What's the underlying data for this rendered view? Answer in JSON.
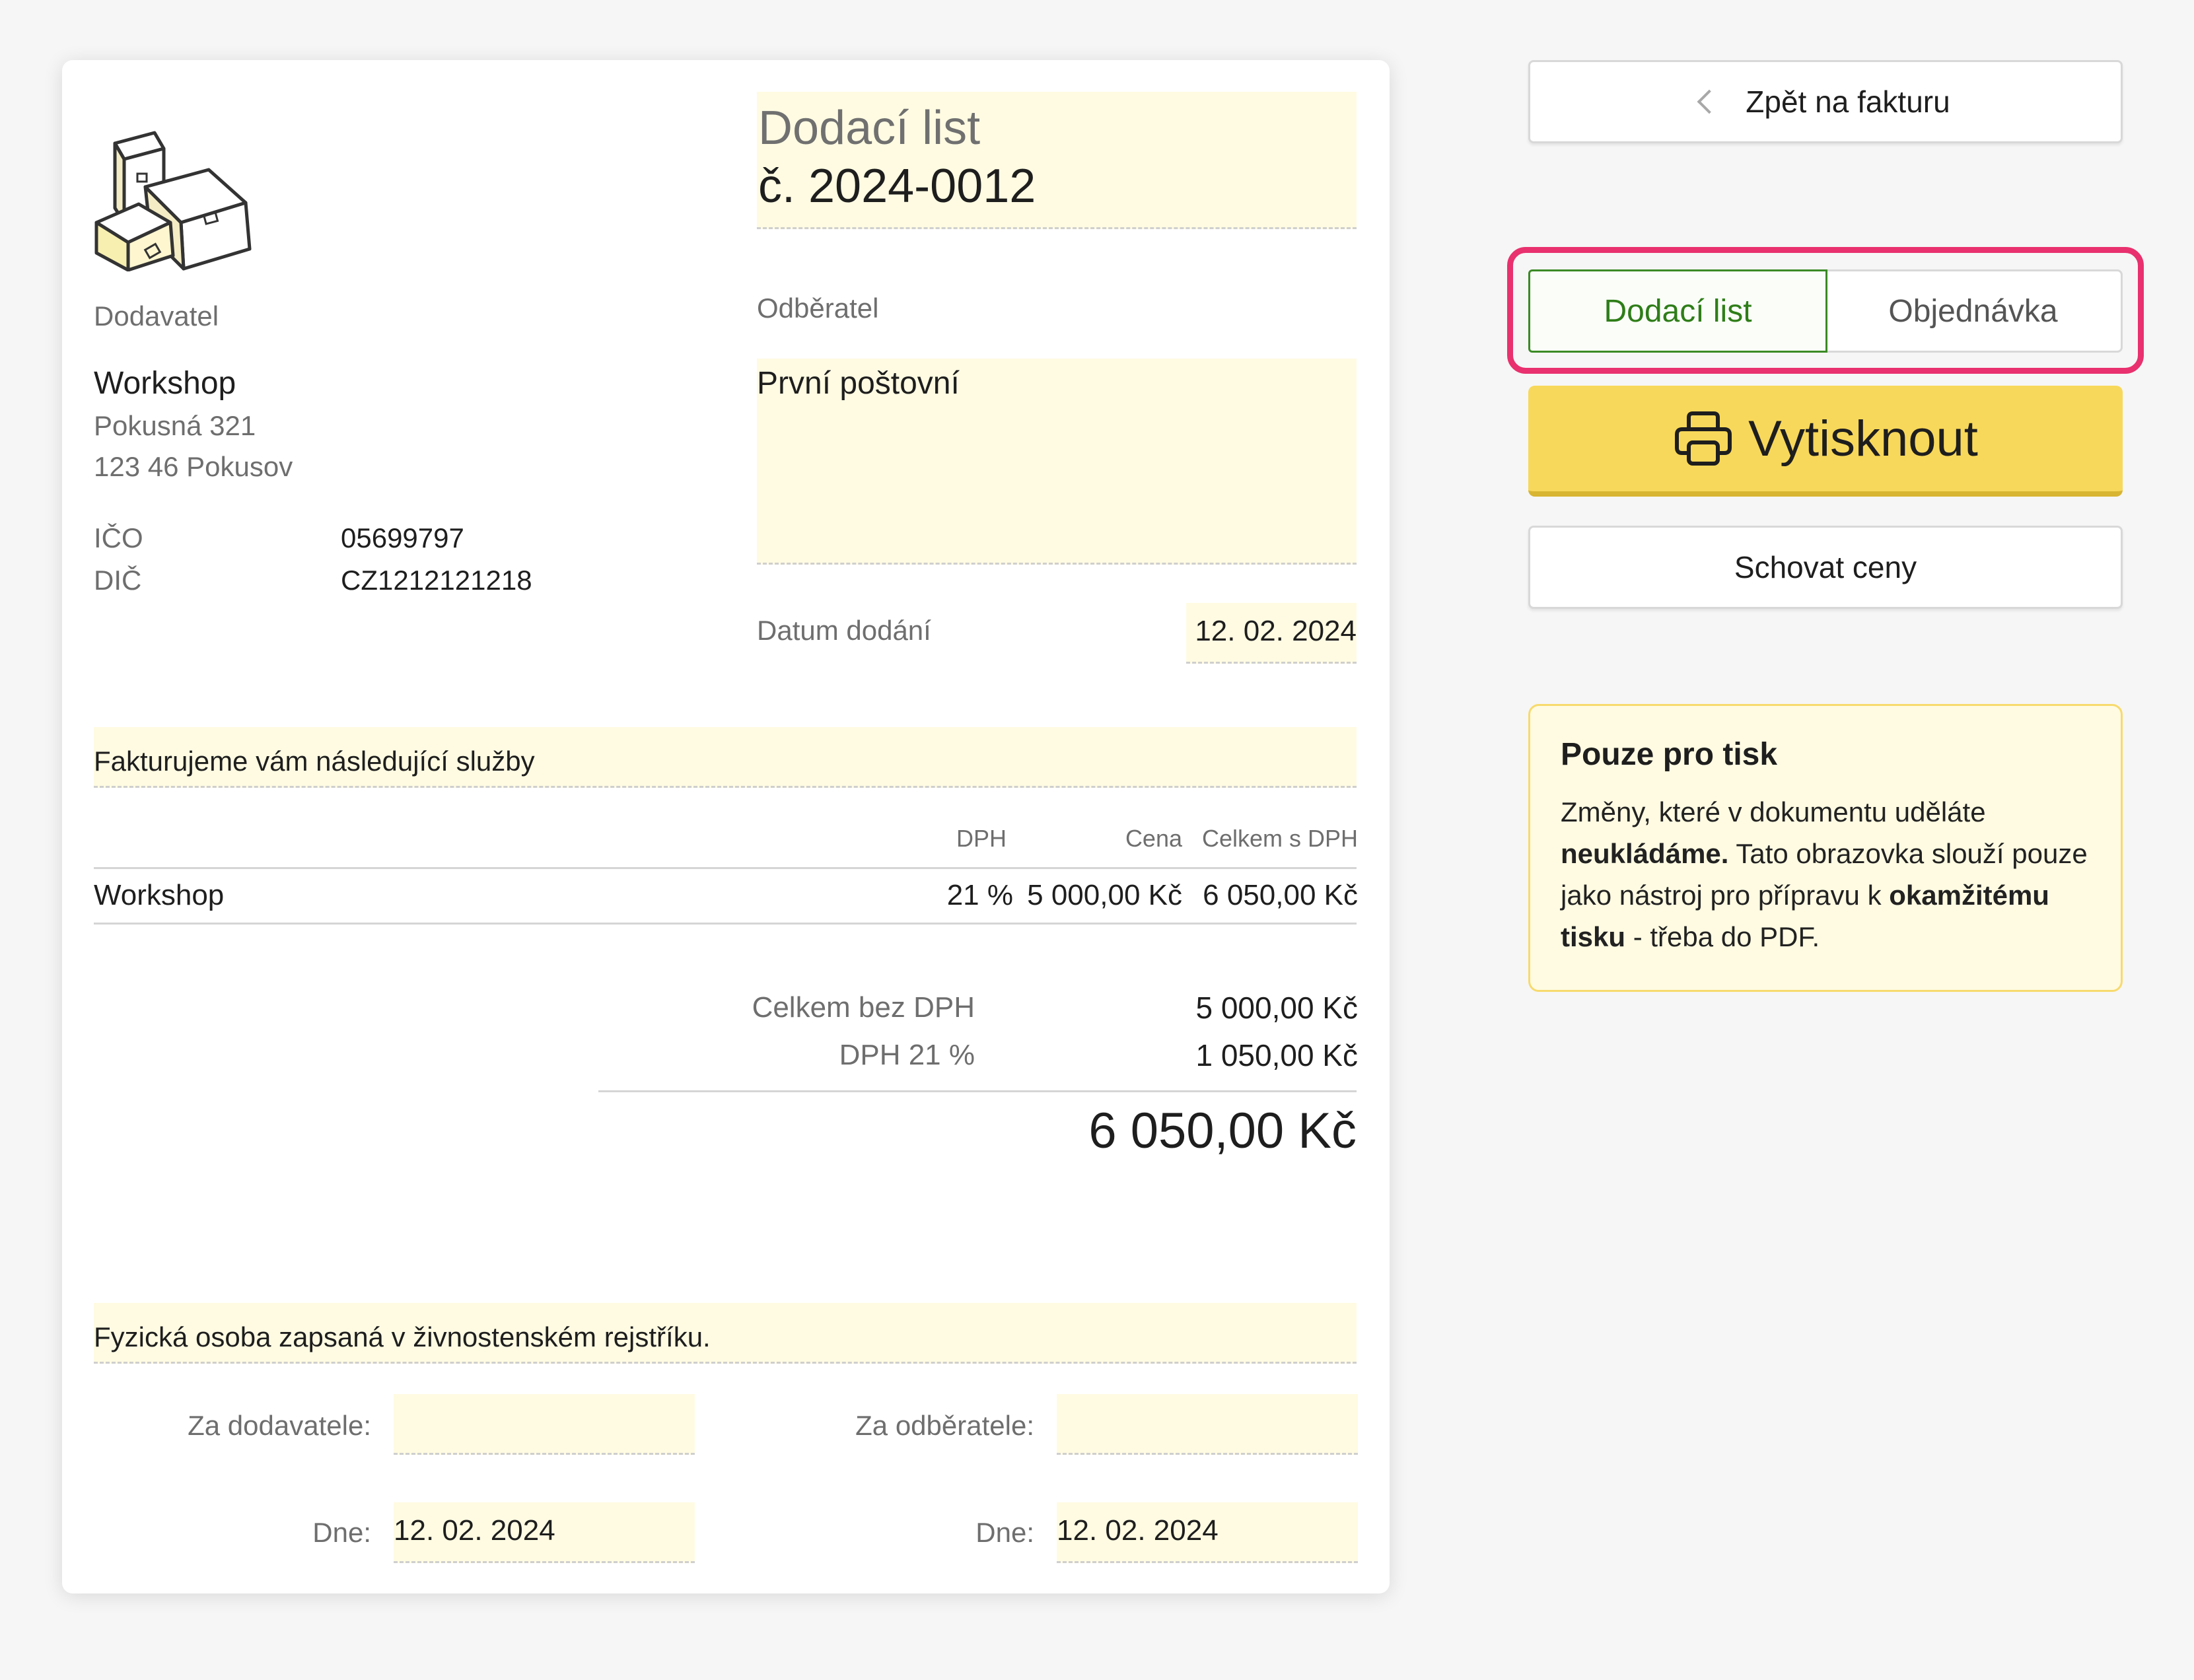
{
  "document": {
    "title": "Dodací list",
    "number": "č. 2024-0012",
    "supplier": {
      "label": "Dodavatel",
      "name": "Workshop",
      "street": "Pokusná 321",
      "city": "123 46 Pokusov",
      "ico_label": "IČO",
      "ico": "05699797",
      "dic_label": "DIČ",
      "dic": "CZ1212121218"
    },
    "customer": {
      "label": "Odběratel",
      "name": "První poštovní"
    },
    "delivery_date": {
      "label": "Datum dodání",
      "value": "12. 02. 2024"
    },
    "intro": "Fakturujeme vám následující služby",
    "table": {
      "headers": {
        "vat": "DPH",
        "price": "Cena",
        "total": "Celkem s DPH"
      },
      "rows": [
        {
          "name": "Workshop",
          "vat": "21 %",
          "price": "5 000,00 Kč",
          "total": "6 050,00 Kč"
        }
      ]
    },
    "summary": {
      "without_vat_label": "Celkem bez DPH",
      "without_vat": "5 000,00 Kč",
      "vat_label": "DPH 21 %",
      "vat": "1 050,00 Kč",
      "total": "6 050,00 Kč"
    },
    "footer_note": "Fyzická osoba zapsaná v živnostenském rejstříku.",
    "signatures": {
      "supplier_label": "Za dodavatele:",
      "customer_label": "Za odběratele:",
      "date_label": "Dne:",
      "supplier_date": "12. 02. 2024",
      "customer_date": "12. 02. 2024"
    }
  },
  "panel": {
    "back_label": "Zpět na fakturu",
    "tabs": [
      {
        "label": "Dodací list",
        "active": true
      },
      {
        "label": "Objednávka",
        "active": false
      }
    ],
    "print_label": "Vytisknout",
    "hide_prices_label": "Schovat ceny",
    "info": {
      "title": "Pouze pro tisk",
      "line1_a": "Změny, které v dokumentu uděláte ",
      "line1_b": "neukládáme.",
      "line1_c": " Tato obrazovka slouží pouze jako nástroj pro přípravu k ",
      "line1_d": "okamžitému tisku",
      "line1_e": " - třeba do PDF."
    }
  },
  "colors": {
    "accent_yellow": "#f8d85a",
    "field_bg": "#fffbe2",
    "active_green": "#2e7d18",
    "highlight_pink": "#e8316e"
  }
}
